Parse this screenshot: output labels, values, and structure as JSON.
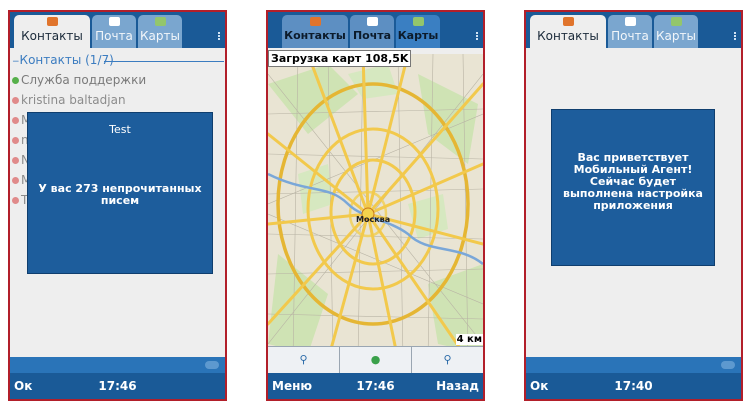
{
  "screen1": {
    "tabs": [
      {
        "label": "Контакты",
        "icon": "contacts-icon",
        "color": "#e0742c"
      },
      {
        "label": "Почта",
        "icon": "mail-icon",
        "color": "#ffffff"
      },
      {
        "label": "Карты",
        "icon": "maps-icon",
        "color": "#93c66c"
      }
    ],
    "list_header": "Контакты (1/7)",
    "contacts": [
      {
        "name": "Служба поддержки",
        "status": "#56b04a"
      },
      {
        "name": "kristina baltadjan",
        "status": "#e08a8a"
      },
      {
        "name": "M",
        "status": "#e08a8a"
      },
      {
        "name": "n",
        "status": "#e08a8a"
      },
      {
        "name": "N",
        "status": "#e08a8a"
      },
      {
        "name": "M",
        "status": "#e08a8a"
      },
      {
        "name": "T",
        "status": "#e08a8a"
      }
    ],
    "popup": {
      "title": "Test",
      "message": "У вас 273 непрочитанных писем"
    },
    "softkeys": {
      "left": "Ок",
      "middle": "17:46",
      "right": ""
    }
  },
  "screen2": {
    "tabs": [
      {
        "label": "Контакты",
        "icon": "contacts-icon",
        "color": "#e0742c"
      },
      {
        "label": "Почта",
        "icon": "mail-icon",
        "color": "#ffffff"
      },
      {
        "label": "Карты",
        "icon": "maps-icon",
        "color": "#93c66c"
      }
    ],
    "loading": "Загрузка карт 108,5K",
    "city_label": "Москва",
    "scale": "4 км",
    "map_tools": [
      "search-icon",
      "globe-icon",
      "zoom-icon"
    ],
    "softkeys": {
      "left": "Меню",
      "middle": "17:46",
      "right": "Назад"
    }
  },
  "screen3": {
    "tabs": [
      {
        "label": "Контакты",
        "icon": "contacts-icon",
        "color": "#e0742c"
      },
      {
        "label": "Почта",
        "icon": "mail-icon",
        "color": "#ffffff"
      },
      {
        "label": "Карты",
        "icon": "maps-icon",
        "color": "#93c66c"
      }
    ],
    "popup": {
      "message": "Вас приветствует Мобильный Агент! Сейчас будет выполнена настройка приложения"
    },
    "softkeys": {
      "left": "Ок",
      "middle": "17:40",
      "right": ""
    }
  }
}
